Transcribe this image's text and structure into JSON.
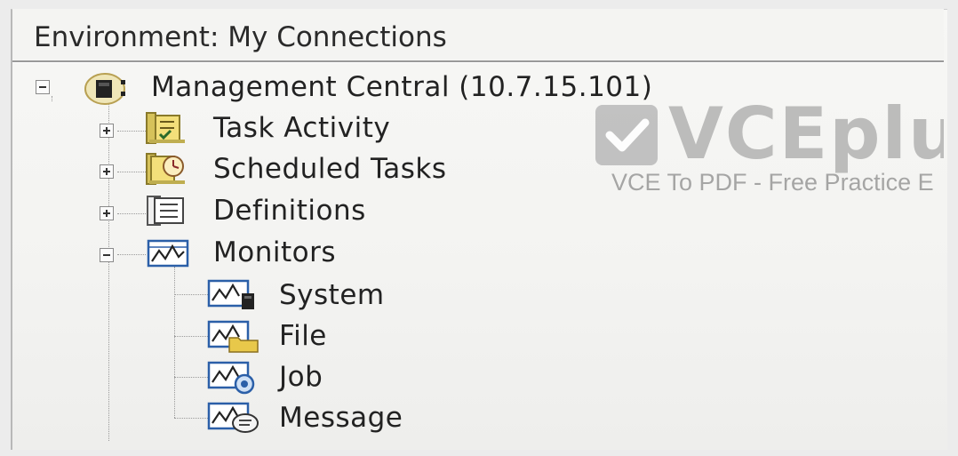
{
  "environment": {
    "label": "Environment: My Connections"
  },
  "tree": {
    "root": {
      "label": "Management Central (10.7.15.101)",
      "expanded": true,
      "icon": "management-central-icon"
    },
    "children": [
      {
        "label": "Task Activity",
        "expanded": false,
        "icon": "task-activity-icon"
      },
      {
        "label": "Scheduled Tasks",
        "expanded": false,
        "icon": "scheduled-tasks-icon"
      },
      {
        "label": "Definitions",
        "expanded": false,
        "icon": "definitions-icon"
      },
      {
        "label": "Monitors",
        "expanded": true,
        "icon": "monitors-icon"
      }
    ],
    "monitors": [
      {
        "label": "System",
        "icon": "system-monitor-icon"
      },
      {
        "label": "File",
        "icon": "file-monitor-icon"
      },
      {
        "label": "Job",
        "icon": "job-monitor-icon"
      },
      {
        "label": "Message",
        "icon": "message-monitor-icon"
      }
    ]
  },
  "watermark": {
    "brand": "VCEplu",
    "tagline": "VCE To PDF - Free Practice E"
  },
  "colors": {
    "background": "#f4f4f2",
    "text": "#222222",
    "monitor_icon": "#2b5fa8",
    "folder_yellow": "#e8c84a"
  }
}
